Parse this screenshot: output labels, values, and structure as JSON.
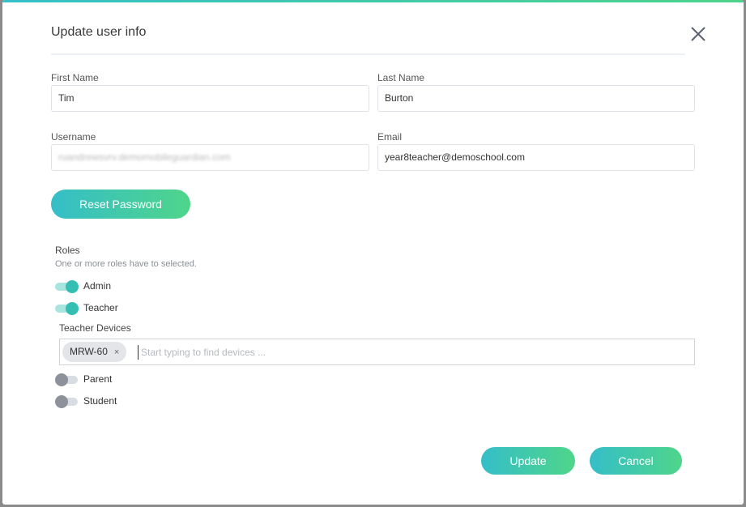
{
  "modal": {
    "title": "Update user info",
    "close_icon": "close-icon"
  },
  "form": {
    "first_name": {
      "label": "First Name",
      "value": "Tim"
    },
    "last_name": {
      "label": "Last Name",
      "value": "Burton"
    },
    "username": {
      "label": "Username",
      "value": "ruandrewsvrv.demomobileguardian.com"
    },
    "email": {
      "label": "Email",
      "value": "year8teacher@demoschool.com"
    },
    "reset_password_label": "Reset Password"
  },
  "roles": {
    "title": "Roles",
    "hint": "One or more roles have to selected.",
    "items": [
      {
        "label": "Admin",
        "enabled": true
      },
      {
        "label": "Teacher",
        "enabled": true
      },
      {
        "label": "Parent",
        "enabled": false
      },
      {
        "label": "Student",
        "enabled": false
      }
    ],
    "teacher_devices": {
      "label": "Teacher Devices",
      "chips": [
        {
          "label": "MRW-60",
          "remove_symbol": "×"
        }
      ],
      "placeholder": "Start typing to find devices ..."
    }
  },
  "footer": {
    "update_label": "Update",
    "cancel_label": "Cancel"
  },
  "colors": {
    "accent_start": "#35bec8",
    "accent_end": "#4fd58a",
    "toggle_on": "#34bfb2",
    "toggle_off": "#8d929a"
  }
}
